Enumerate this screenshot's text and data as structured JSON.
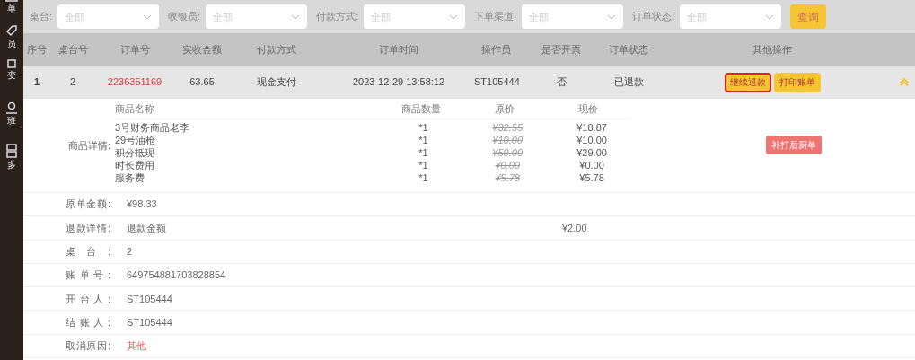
{
  "sidebar": {
    "items": [
      {
        "label": "单"
      },
      {
        "label": "员"
      },
      {
        "label": "变"
      },
      {
        "label": "班"
      },
      {
        "label": "多"
      }
    ]
  },
  "filters": [
    {
      "label": "桌台:",
      "placeholder": "全部"
    },
    {
      "label": "收银员:",
      "placeholder": "全部"
    },
    {
      "label": "付款方式:",
      "placeholder": "全部"
    },
    {
      "label": "下单渠道:",
      "placeholder": "全部"
    },
    {
      "label": "订单状态:",
      "placeholder": "全部"
    }
  ],
  "query_button": "查询",
  "table": {
    "columns": [
      "序号",
      "桌台号",
      "订单号",
      "实收金额",
      "付款方式",
      "订单时间",
      "操作员",
      "是否开票",
      "订单状态",
      "其他操作"
    ],
    "rows": [
      {
        "index": "1",
        "table_no": "2",
        "order_no": "2236351169",
        "amount": "63.65",
        "payment": "现金支付",
        "time": "2023-12-29 13:58:12",
        "operator": "ST105444",
        "invoice": "否",
        "status": "已退款",
        "expanded": true,
        "actions": [
          {
            "label": "继续退款",
            "focused": true
          },
          {
            "label": "打印账单",
            "focused": false
          }
        ],
        "detail": {
          "goods_label": "商品详情:",
          "goods_columns": [
            "商品名称",
            "商品数量",
            "原价",
            "现价"
          ],
          "goods": [
            {
              "name": "3号财务商品老李",
              "qty": "*1",
              "original_price": "¥32.55",
              "current_price": "¥18.87"
            },
            {
              "name": "29号油枪",
              "qty": "*1",
              "original_price": "¥10.00",
              "current_price": "¥10.00"
            },
            {
              "name": "积分抵现",
              "qty": "*1",
              "original_price": "¥50.00",
              "current_price": "¥29.00"
            },
            {
              "name": "时长费用",
              "qty": "*1",
              "original_price": "¥0.00",
              "current_price": "¥0.00"
            },
            {
              "name": "服务费",
              "qty": "*1",
              "original_price": "¥5.78",
              "current_price": "¥5.78"
            }
          ],
          "reprint_button": "补打后厨单",
          "fields": [
            {
              "label": "原单金额:",
              "value": "¥98.33",
              "warning": false
            },
            {
              "label": "退款详情:",
              "value": "退款金额",
              "amount": "¥2.00",
              "warning": false
            },
            {
              "label": "桌台:",
              "value": "2",
              "warning": false
            },
            {
              "label": "账单号:",
              "value": "649754881703828854",
              "warning": false
            },
            {
              "label": "开台人:",
              "value": "ST105444",
              "warning": false
            },
            {
              "label": "结账人:",
              "value": "ST105444",
              "warning": false
            },
            {
              "label": "取消原因:",
              "value": "其他",
              "warning": true
            }
          ]
        }
      }
    ]
  }
}
